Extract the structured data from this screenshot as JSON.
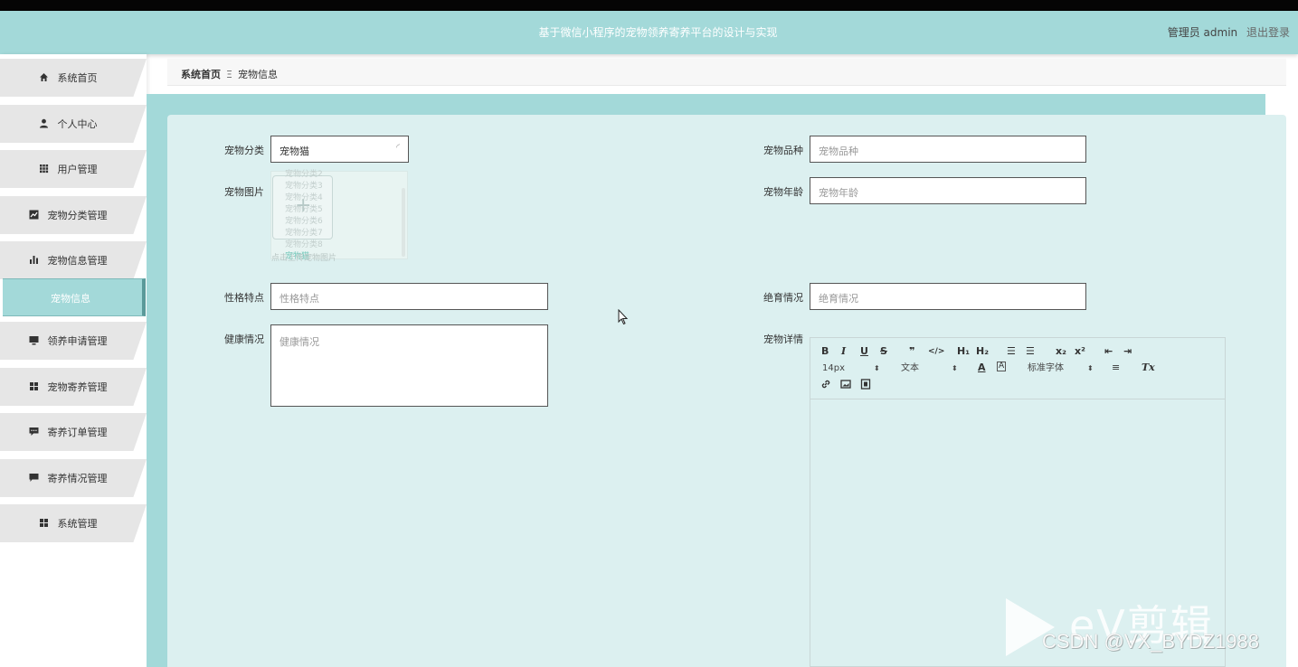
{
  "header": {
    "title": "基于微信小程序的宠物领养寄养平台的设计与实现",
    "user_label": "管理员 admin",
    "logout_label": "退出登录"
  },
  "sidebar": {
    "items": [
      {
        "label": "系统首页",
        "icon": "home-icon"
      },
      {
        "label": "个人中心",
        "icon": "user-icon"
      },
      {
        "label": "用户管理",
        "icon": "grid-icon"
      },
      {
        "label": "宠物分类管理",
        "icon": "line-chart-icon"
      },
      {
        "label": "宠物信息管理",
        "icon": "bar-chart-icon"
      },
      {
        "label": "领养申请管理",
        "icon": "monitor-icon"
      },
      {
        "label": "宠物寄养管理",
        "icon": "apps-icon"
      },
      {
        "label": "寄养订单管理",
        "icon": "comment-icon"
      },
      {
        "label": "寄养情况管理",
        "icon": "chat-icon"
      },
      {
        "label": "系统管理",
        "icon": "apps-icon"
      }
    ],
    "active_sub": "宠物信息"
  },
  "breadcrumb": {
    "home": "系统首页",
    "separator": "Ξ",
    "current": "宠物信息"
  },
  "form": {
    "category_label": "宠物分类",
    "category_value": "宠物猫",
    "breed_label": "宠物品种",
    "breed_placeholder": "宠物品种",
    "image_label": "宠物图片",
    "age_label": "宠物年龄",
    "age_placeholder": "宠物年龄",
    "trait_label": "性格特点",
    "trait_placeholder": "性格特点",
    "sterile_label": "绝育情况",
    "sterile_placeholder": "绝育情况",
    "health_label": "健康情况",
    "health_placeholder": "健康情况",
    "detail_label": "宠物详情",
    "upload_tip": "点击上传宠物图片",
    "dropdown_options": [
      "宠物分类2",
      "宠物分类3",
      "宠物分类4",
      "宠物分类5",
      "宠物分类6",
      "宠物分类7",
      "宠物分类8",
      "宠物猫"
    ]
  },
  "editor": {
    "toolbar": {
      "bold": "B",
      "italic": "I",
      "underline": "U",
      "strike": "S",
      "quote": "❞",
      "code": "</>",
      "h1": "H₁",
      "h2": "H₂",
      "ol": "☰",
      "ul": "☰",
      "sub": "x₂",
      "sup": "x²",
      "outdent": "⇤",
      "indent": "⇥",
      "size": "14px",
      "header": "文本",
      "font": "标准字体",
      "align": "≡",
      "clean": "Tx"
    }
  },
  "watermark": {
    "logo_text": "eV剪辑",
    "csdn": "CSDN @VX_BYDZ1988"
  }
}
